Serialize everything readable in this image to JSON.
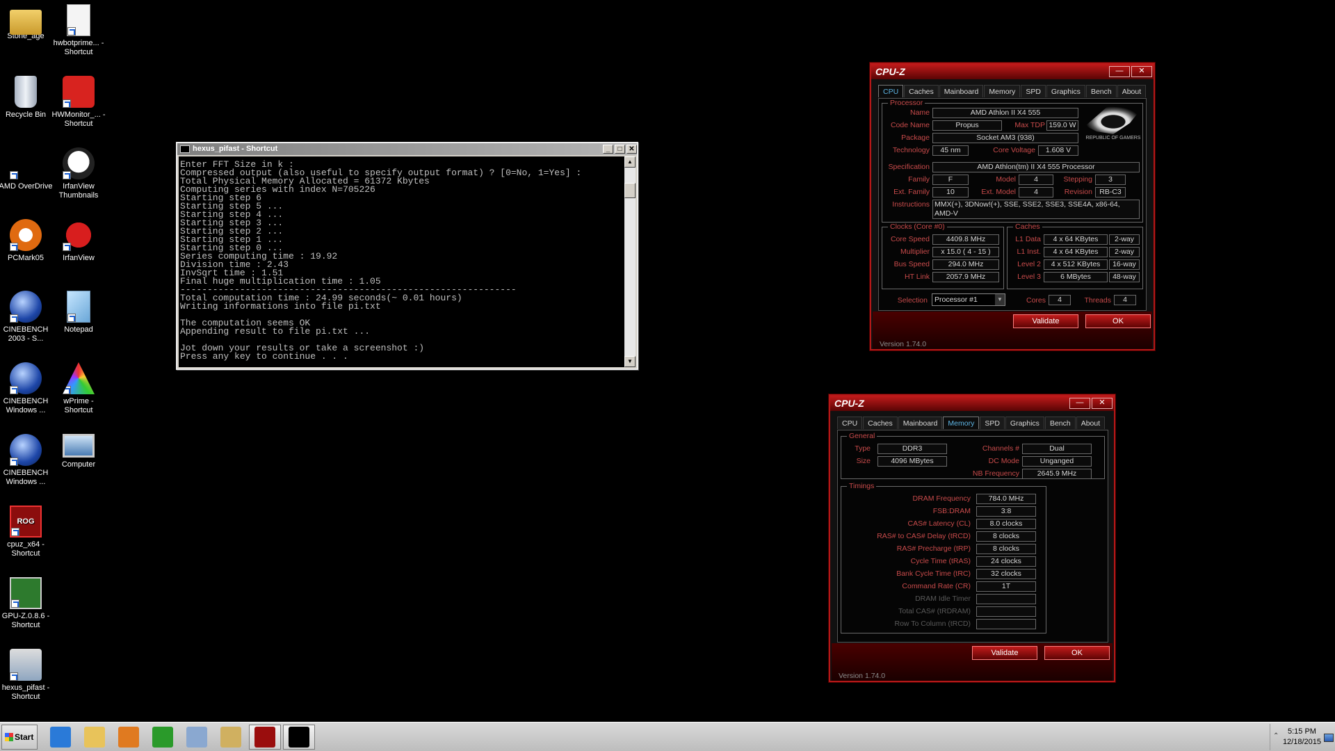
{
  "desktop": {
    "icons": [
      {
        "label": "Stone_age",
        "icon": "folder-icon"
      },
      {
        "label": "hwbotprime... - Shortcut",
        "icon": "java-document-icon"
      },
      {
        "label": "Recycle Bin",
        "icon": "recycle-bin-icon"
      },
      {
        "label": "HWMonitor_... - Shortcut",
        "icon": "hwmonitor-icon"
      },
      {
        "label": "AMD OverDrive",
        "icon": "amd-icon"
      },
      {
        "label": "IrfanView Thumbnails",
        "icon": "panda-icon"
      },
      {
        "label": "PCMark05",
        "icon": "pcmark-icon"
      },
      {
        "label": "IrfanView",
        "icon": "irfanview-icon"
      },
      {
        "label": "CINEBENCH 2003 - S...",
        "icon": "cinebench-icon"
      },
      {
        "label": "Notepad",
        "icon": "notepad-icon"
      },
      {
        "label": "CINEBENCH Windows ...",
        "icon": "cinebench-icon"
      },
      {
        "label": "wPrime - Shortcut",
        "icon": "wprime-icon"
      },
      {
        "label": "CINEBENCH Windows ...",
        "icon": "cinebench-icon"
      },
      {
        "label": "Computer",
        "icon": "computer-icon"
      },
      {
        "label": "cpuz_x64 - Shortcut",
        "icon": "rog-cpuz-icon",
        "glyph": "ROG"
      },
      {
        "label": "GPU-Z.0.8.6 - Shortcut",
        "icon": "gpuz-icon"
      },
      {
        "label": "hexus_pifast - Shortcut",
        "icon": "pifast-icon"
      }
    ]
  },
  "console": {
    "title": "hexus_pifast - Shortcut",
    "lines": "Enter FFT Size in k :\nCompressed output (also useful to specify output format) ? [0=No, 1=Yes] :\nTotal Physical Memory Allocated = 61372 Kbytes\nComputing series with index N=705226\nStarting step 6\nStarting step 5 ...\nStarting step 4 ...\nStarting step 3 ...\nStarting step 2 ...\nStarting step 1 ...\nStarting step 0 ...\nSeries computing time : 19.92\nDivision time : 2.43\nInvSqrt time : 1.51\nFinal huge multiplication time : 1.05\n--------------------------------------------------------------\nTotal computation time : 24.99 seconds(~ 0.01 hours)\nWriting informations into file pi.txt\n\nThe computation seems OK\nAppending result to file pi.txt ...\n\nJot down your results or take a screenshot :)\nPress any key to continue . . ."
  },
  "cpuz_common": {
    "title": "CPU-Z",
    "tabs": [
      "CPU",
      "Caches",
      "Mainboard",
      "Memory",
      "SPD",
      "Graphics",
      "Bench",
      "About"
    ],
    "validate": "Validate",
    "ok": "OK",
    "version": "Version 1.74.0"
  },
  "cpu_tab": {
    "processor_group": "Processor",
    "name_label": "Name",
    "name": "AMD Athlon II X4 555",
    "codename_label": "Code Name",
    "codename": "Propus",
    "maxtdp_label": "Max TDP",
    "maxtdp": "159.0 W",
    "package_label": "Package",
    "package": "Socket AM3 (938)",
    "tech_label": "Technology",
    "tech": "45 nm",
    "corevolt_label": "Core Voltage",
    "corevolt": "1.608 V",
    "spec_label": "Specification",
    "spec": "AMD Athlon(tm) II X4 555 Processor",
    "family_label": "Family",
    "family": "F",
    "model_label": "Model",
    "model": "4",
    "stepping_label": "Stepping",
    "stepping": "3",
    "extfamily_label": "Ext. Family",
    "extfamily": "10",
    "extmodel_label": "Ext. Model",
    "extmodel": "4",
    "revision_label": "Revision",
    "revision": "RB-C3",
    "instr_label": "Instructions",
    "instr": "MMX(+), 3DNow!(+), SSE, SSE2, SSE3, SSE4A, x86-64, AMD-V",
    "rog_text": "REPUBLIC OF GAMERS",
    "clocks_group": "Clocks (Core #0)",
    "corespeed_label": "Core Speed",
    "corespeed": "4409.8 MHz",
    "mult_label": "Multiplier",
    "mult": "x 15.0 ( 4 - 15 )",
    "bus_label": "Bus Speed",
    "bus": "294.0 MHz",
    "ht_label": "HT Link",
    "ht": "2057.9 MHz",
    "caches_group": "Caches",
    "l1d_label": "L1 Data",
    "l1d": "4 x 64 KBytes",
    "l1d_way": "2-way",
    "l1i_label": "L1 Inst.",
    "l1i": "4 x 64 KBytes",
    "l1i_way": "2-way",
    "l2_label": "Level 2",
    "l2": "4 x 512 KBytes",
    "l2_way": "16-way",
    "l3_label": "Level 3",
    "l3": "6 MBytes",
    "l3_way": "48-way",
    "selection_label": "Selection",
    "selection": "Processor #1",
    "cores_label": "Cores",
    "cores": "4",
    "threads_label": "Threads",
    "threads": "4"
  },
  "mem_tab": {
    "general_group": "General",
    "type_label": "Type",
    "type": "DDR3",
    "size_label": "Size",
    "size": "4096 MBytes",
    "channels_label": "Channels #",
    "channels": "Dual",
    "dcmode_label": "DC Mode",
    "dcmode": "Unganged",
    "nbfreq_label": "NB Frequency",
    "nbfreq": "2645.9 MHz",
    "timings_group": "Timings",
    "timings": [
      {
        "label": "DRAM Frequency",
        "value": "784.0 MHz",
        "dim": false
      },
      {
        "label": "FSB:DRAM",
        "value": "3:8",
        "dim": false
      },
      {
        "label": "CAS# Latency (CL)",
        "value": "8.0 clocks",
        "dim": false
      },
      {
        "label": "RAS# to CAS# Delay (tRCD)",
        "value": "8 clocks",
        "dim": false
      },
      {
        "label": "RAS# Precharge (tRP)",
        "value": "8 clocks",
        "dim": false
      },
      {
        "label": "Cycle Time (tRAS)",
        "value": "24 clocks",
        "dim": false
      },
      {
        "label": "Bank Cycle Time (tRC)",
        "value": "32 clocks",
        "dim": false
      },
      {
        "label": "Command Rate (CR)",
        "value": "1T",
        "dim": false
      },
      {
        "label": "DRAM Idle Timer",
        "value": "",
        "dim": true
      },
      {
        "label": "Total CAS# (tRDRAM)",
        "value": "",
        "dim": true
      },
      {
        "label": "Row To Column (tRCD)",
        "value": "",
        "dim": true
      }
    ]
  },
  "taskbar": {
    "start_label": "Start",
    "apps": [
      {
        "name": "internet-explorer-icon",
        "color": "#2a7ad8"
      },
      {
        "name": "explorer-icon",
        "color": "#e8c35a"
      },
      {
        "name": "media-player-icon",
        "color": "#e07a20"
      },
      {
        "name": "super-pi-icon",
        "color": "#2a9a2a"
      },
      {
        "name": "calculator-icon",
        "color": "#8aa8d0"
      },
      {
        "name": "paint-icon",
        "color": "#d0b060"
      },
      {
        "name": "rog-cpuz-icon",
        "color": "#9a0d0d"
      },
      {
        "name": "command-prompt-icon",
        "color": "#000000"
      }
    ],
    "time": "5:15 PM",
    "date": "12/18/2015"
  }
}
